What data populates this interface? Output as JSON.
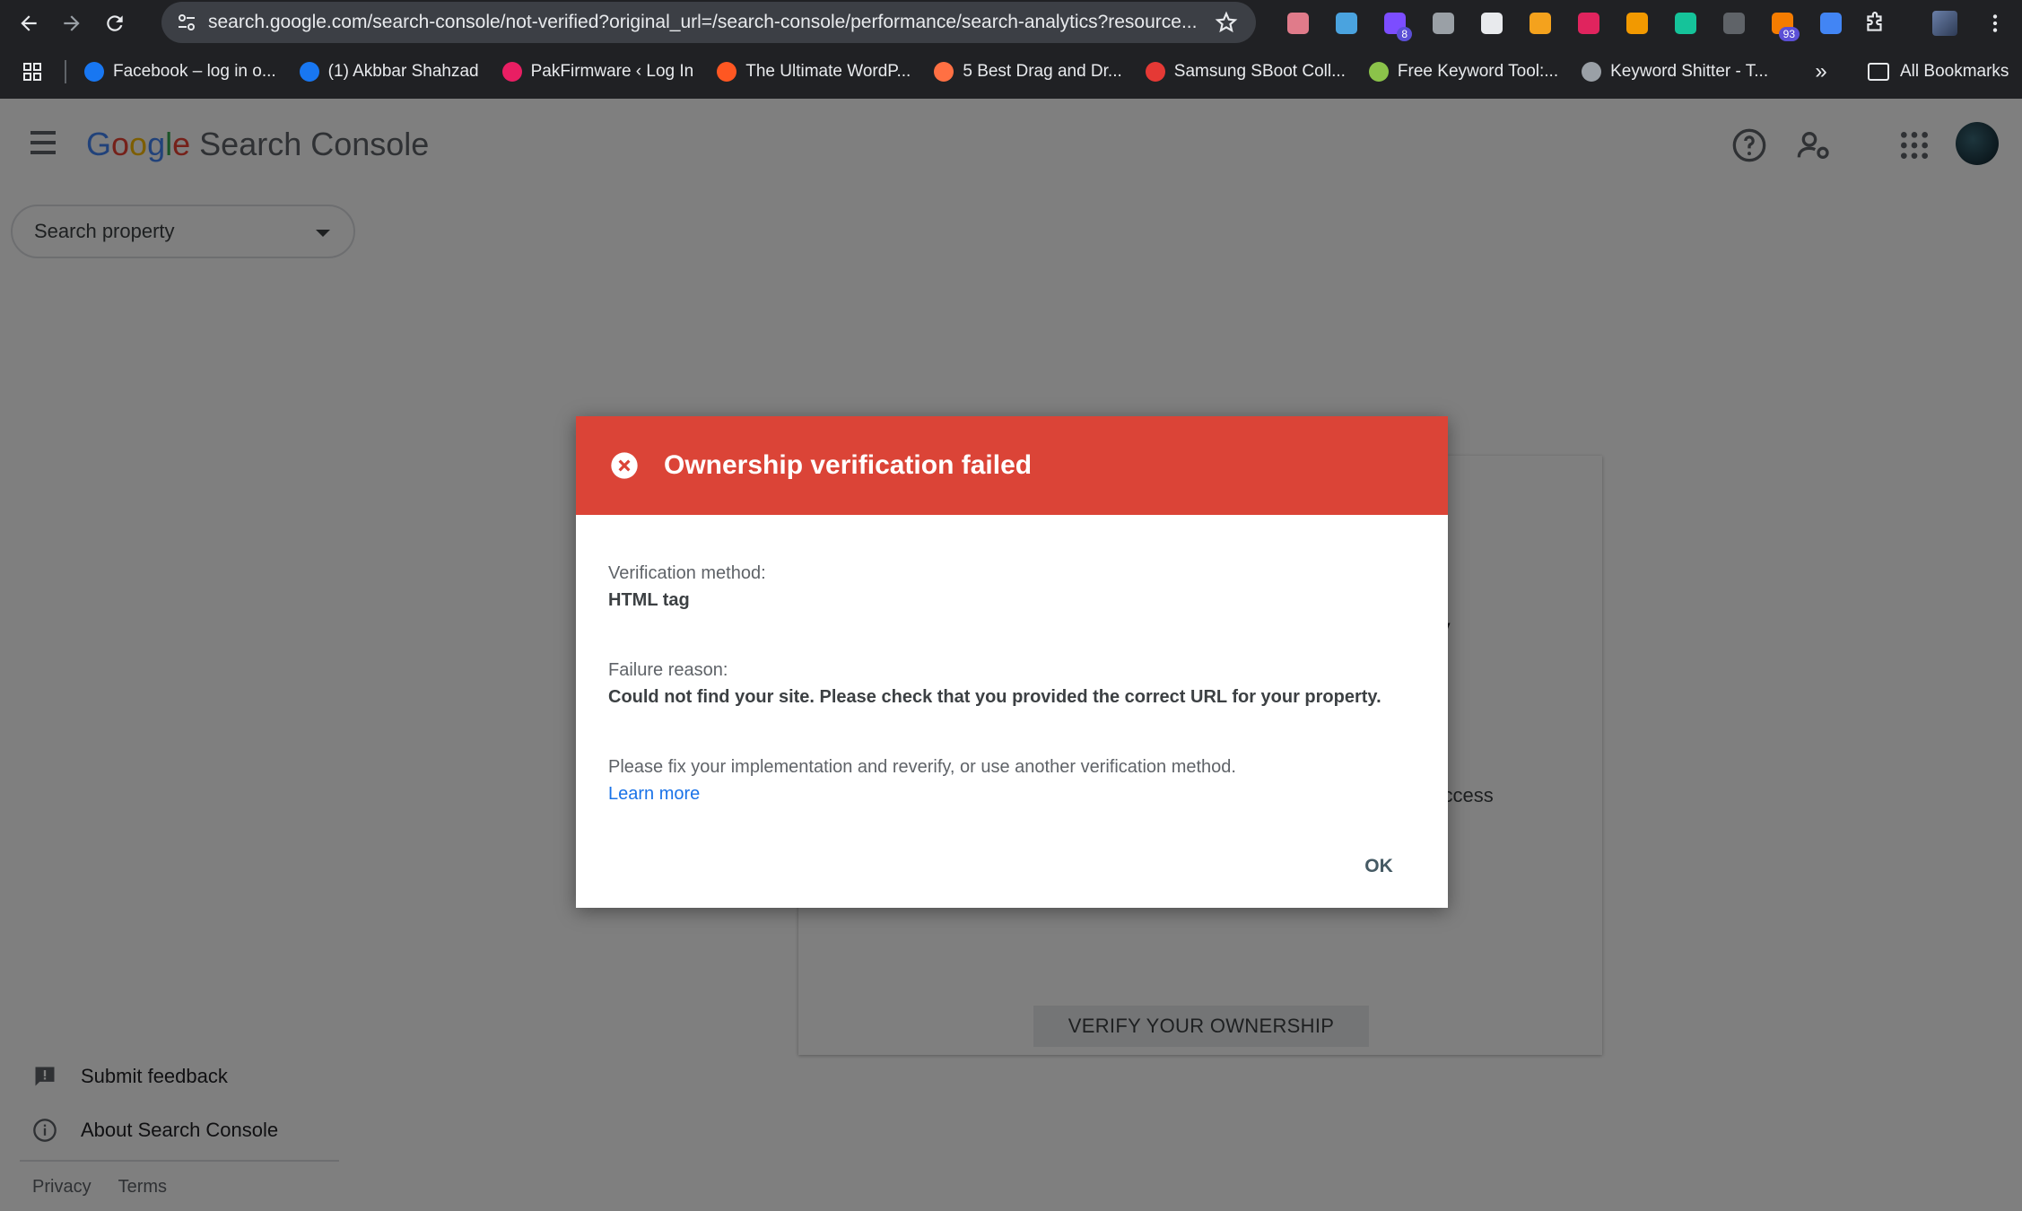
{
  "browser": {
    "url": "search.google.com/search-console/not-verified?original_url=/search-console/performance/search-analytics?resource...",
    "extensions": [
      {
        "icon": "camera-extension-icon",
        "color": "#e07b8a",
        "badge": ""
      },
      {
        "icon": "m-extension-icon",
        "color": "#4aa3df",
        "badge": ""
      },
      {
        "icon": "puzzle-purple-icon",
        "color": "#7c4dff",
        "badge": "8"
      },
      {
        "icon": "shield-extension-icon",
        "color": "#9aa0a6",
        "badge": ""
      },
      {
        "icon": "eyedropper-icon",
        "color": "#e8eaed",
        "badge": ""
      },
      {
        "icon": "sq-extension-icon",
        "color": "#f4a21d",
        "badge": ""
      },
      {
        "icon": "k-extension-icon",
        "color": "#e0245e",
        "badge": ""
      },
      {
        "icon": "crescent-extension-icon",
        "color": "#f29900",
        "badge": ""
      },
      {
        "icon": "grammarly-icon",
        "color": "#15c39a",
        "badge": ""
      },
      {
        "icon": "mouse-extension-icon",
        "color": "#5f6368",
        "badge": ""
      },
      {
        "icon": "orange-extension-icon",
        "color": "#f57c00",
        "badge": "93"
      },
      {
        "icon": "blue-extension-icon",
        "color": "#4285f4",
        "badge": ""
      }
    ],
    "bookmarks": [
      {
        "label": "Facebook – log in o...",
        "color": "#1877f2"
      },
      {
        "label": "(1) Akbbar Shahzad",
        "color": "#1877f2"
      },
      {
        "label": "PakFirmware ‹ Log In",
        "color": "#e91e63"
      },
      {
        "label": "The Ultimate WordP...",
        "color": "#ff5722"
      },
      {
        "label": "5 Best Drag and Dr...",
        "color": "#ff7043"
      },
      {
        "label": "Samsung SBoot Coll...",
        "color": "#e53935"
      },
      {
        "label": "Free Keyword Tool:...",
        "color": "#8bc34a"
      },
      {
        "label": "Keyword Shitter - T...",
        "color": "#9aa0a6"
      }
    ],
    "all_bookmarks": "All Bookmarks"
  },
  "app": {
    "logo_google": "Google",
    "logo_product": "Search Console",
    "search_property": "Search property",
    "submit_feedback": "Submit feedback",
    "about": "About Search Console",
    "privacy": "Privacy",
    "terms": "Terms",
    "bg_fragment_1": "ty",
    "bg_fragment_2": "t access",
    "verify_button": "VERIFY YOUR OWNERSHIP"
  },
  "dialog": {
    "title": "Ownership verification failed",
    "method_label": "Verification method:",
    "method_value": "HTML tag",
    "reason_label": "Failure reason:",
    "reason_value": "Could not find your site. Please check that you provided the correct URL for your property.",
    "instruction": "Please fix your implementation and reverify, or use another verification method.",
    "learn_more": "Learn more",
    "ok": "OK",
    "header_color": "#db4437"
  }
}
